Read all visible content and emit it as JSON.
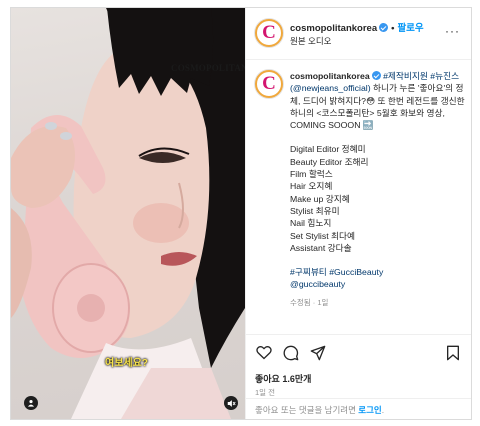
{
  "post": {
    "username": "cosmopolitankorea",
    "follow_label": "팔로우",
    "audio_label": "원본 오디오",
    "more_label": "···"
  },
  "media": {
    "watermark": "COSMOPOLITAN",
    "subtitle": "여보세요?",
    "tag_icon": "person-tag-icon",
    "mute_icon": "speaker-muted-icon"
  },
  "caption": {
    "username": "cosmopolitankorea",
    "tag1": "#제작비지원",
    "tag2": "#뉴진스",
    "mention_paren": "(@newjeans_official)",
    "body1": " 하니가 누른 '좋아요'의 정체, 드디어 밝혀지다?😳 또 한번 레전드를 갱신한 하니의 <코스모폴리탄> 5월호 화보와 영상, COMING SOOON",
    "body_emoji": "🔜",
    "credits": [
      "Digital Editor 정혜미",
      "Beauty Editor 조해리",
      "Film 할럭스",
      "Hair 오지혜",
      "Make up 강지혜",
      "Stylist 최유미",
      "Nail 힘노지",
      "Set Stylist 최다예",
      "Assistant 강다솔"
    ],
    "hashtags": "#구찌뷰티 #GucciBeauty",
    "mention": "@guccibeauty",
    "meta": "수정됨 · 1일"
  },
  "actions": {
    "like_icon": "heart-icon",
    "comment_icon": "comment-icon",
    "share_icon": "send-icon",
    "save_icon": "bookmark-icon"
  },
  "stats": {
    "likes": "좋아요 1.6만개",
    "time": "1일 전"
  },
  "comment_bar": {
    "prompt": "좋아요 또는 댓글을 남기려면 ",
    "login_label": "로그인",
    "suffix": "."
  },
  "colors": {
    "brand": "#d3146f",
    "link": "#00376b",
    "accent": "#0095f6",
    "muted": "#8e8e8e"
  }
}
